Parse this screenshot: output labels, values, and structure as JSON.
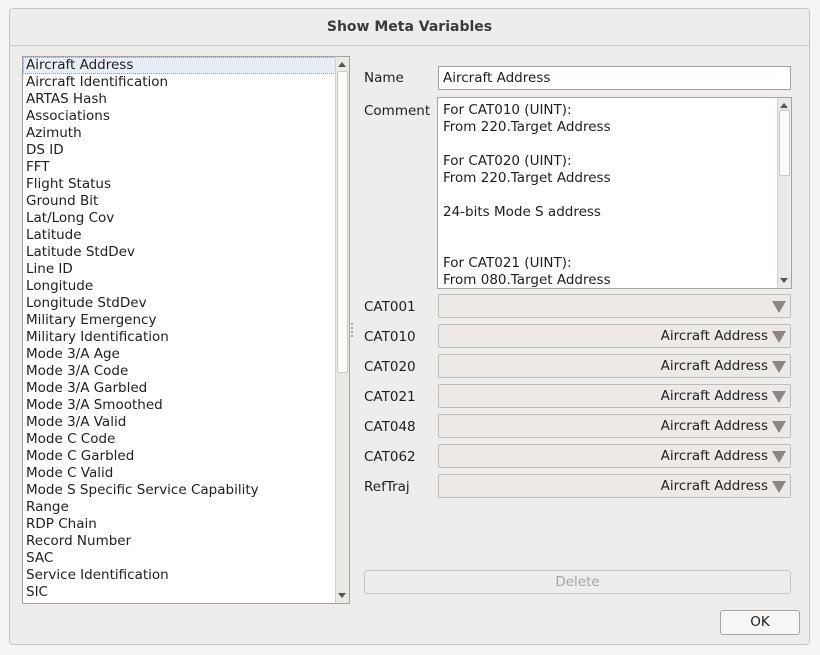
{
  "dialog": {
    "title": "Show Meta Variables"
  },
  "variables": [
    "Aircraft Address",
    "Aircraft Identification",
    "ARTAS Hash",
    "Associations",
    "Azimuth",
    "DS ID",
    "FFT",
    "Flight Status",
    "Ground Bit",
    "Lat/Long Cov",
    "Latitude",
    "Latitude StdDev",
    "Line ID",
    "Longitude",
    "Longitude StdDev",
    "Military Emergency",
    "Military Identification",
    "Mode 3/A Age",
    "Mode 3/A Code",
    "Mode 3/A Garbled",
    "Mode 3/A Smoothed",
    "Mode 3/A Valid",
    "Mode C Code",
    "Mode C Garbled",
    "Mode C Valid",
    "Mode S Specific Service Capability",
    "Range",
    "RDP Chain",
    "Record Number",
    "SAC",
    "Service Identification",
    "SIC"
  ],
  "selected_index": 0,
  "details": {
    "name_label": "Name",
    "name_value": "Aircraft Address",
    "comment_label": "Comment",
    "comment_value": "For CAT010 (UINT):\nFrom 220.Target Address\n\nFor CAT020 (UINT):\nFrom 220.Target Address\n\n24-bits Mode S address\n\n\nFor CAT021 (UINT):\nFrom 080.Target Address"
  },
  "categories": [
    {
      "label": "CAT001",
      "value": ""
    },
    {
      "label": "CAT010",
      "value": "Aircraft Address"
    },
    {
      "label": "CAT020",
      "value": "Aircraft Address"
    },
    {
      "label": "CAT021",
      "value": "Aircraft Address"
    },
    {
      "label": "CAT048",
      "value": "Aircraft Address"
    },
    {
      "label": "CAT062",
      "value": "Aircraft Address"
    },
    {
      "label": "RefTraj",
      "value": "Aircraft Address"
    }
  ],
  "buttons": {
    "delete": "Delete",
    "ok": "OK"
  },
  "icons": {
    "scroll_up": "arrow-up-icon",
    "scroll_down": "arrow-down-icon",
    "combo_drop": "triangle-down-icon"
  }
}
